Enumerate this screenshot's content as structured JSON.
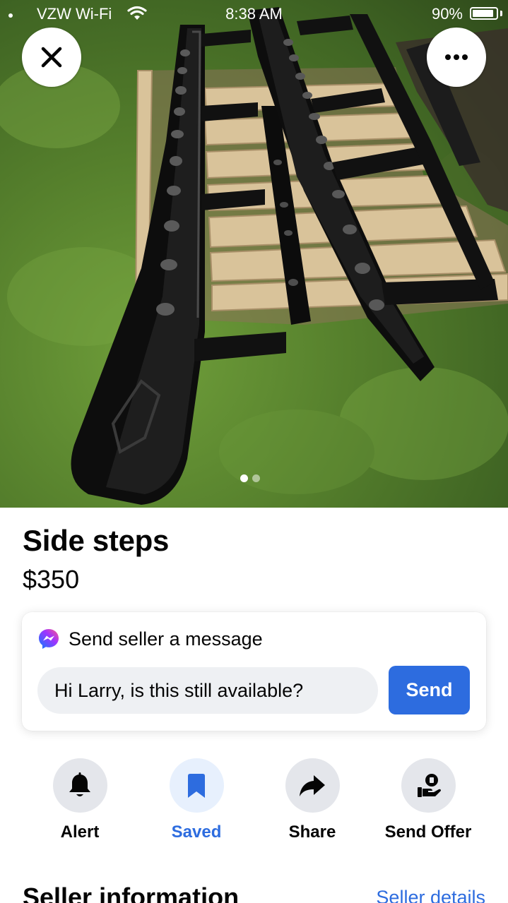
{
  "status_bar": {
    "carrier": "VZW Wi-Fi",
    "time": "8:38 AM",
    "battery": "90%",
    "battery_level": 0.9
  },
  "photo": {
    "description_icon": "listing-photo",
    "page_count": 2,
    "current_page": 1
  },
  "toolbar": {
    "close_icon": "close-icon",
    "more_icon": "more-icon"
  },
  "listing": {
    "title": "Side steps",
    "price": "$350"
  },
  "message": {
    "header_label": "Send seller a message",
    "input_value": "Hi Larry, is this still available?",
    "send_label": "Send"
  },
  "actions": [
    {
      "label": "Alert",
      "icon": "bell-icon"
    },
    {
      "label": "Saved",
      "icon": "bookmark-icon"
    },
    {
      "label": "Share",
      "icon": "share-icon"
    },
    {
      "label": "Send Offer",
      "icon": "send-offer-icon"
    }
  ],
  "seller": {
    "heading": "Seller information",
    "details_link": "Seller details"
  },
  "colors": {
    "accent": "#2d6cdf",
    "icon_bg": "#e4e6eb",
    "saved_bg": "#e7f0fd",
    "input_bg": "#eef0f3"
  }
}
